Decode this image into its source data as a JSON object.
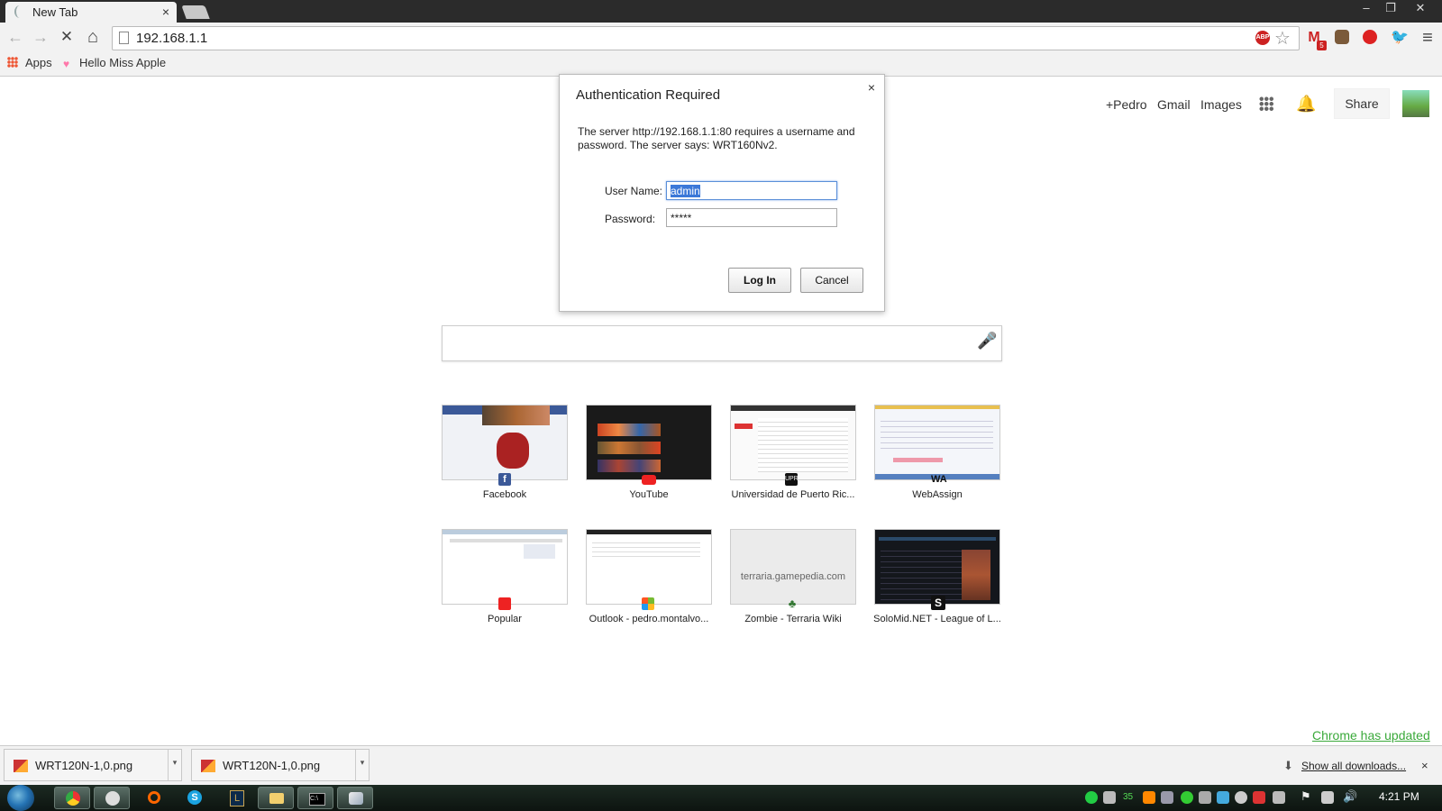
{
  "tab": {
    "title": "New Tab",
    "close": "×"
  },
  "window_controls": {
    "minimize": "–",
    "restore": "❐",
    "close": "✕"
  },
  "toolbar": {
    "back": "←",
    "forward": "→",
    "stop": "✕",
    "home": "⌂",
    "url": "192.168.1.1",
    "abp": "ABP",
    "menu": "≡"
  },
  "extensions": {
    "gmail_badge": "5"
  },
  "bookmarks": [
    {
      "label": "Apps"
    },
    {
      "label": "Hello Miss Apple"
    }
  ],
  "google_header": {
    "plus_name": "+Pedro",
    "gmail": "Gmail",
    "images": "Images",
    "share": "Share"
  },
  "dialog": {
    "title": "Authentication Required",
    "close": "×",
    "message": "The server http://192.168.1.1:80 requires a username and password. The server says: WRT160Nv2.",
    "username_label": "User Name:",
    "username_value": "admin",
    "password_label": "Password:",
    "password_value": "*****",
    "login": "Log In",
    "cancel": "Cancel"
  },
  "tiles": [
    {
      "label": "Facebook"
    },
    {
      "label": "YouTube"
    },
    {
      "label": "Universidad de Puerto Ric..."
    },
    {
      "label": "WebAssign"
    },
    {
      "label": "Popular"
    },
    {
      "label": "Outlook - pedro.montalvo..."
    },
    {
      "label": "Zombie - Terraria Wiki",
      "thumb_text": "terraria.gamepedia.com"
    },
    {
      "label": "SoloMid.NET - League of L..."
    }
  ],
  "downloads": {
    "items": [
      {
        "name": "WRT120N-1,0.png"
      },
      {
        "name": "WRT120N-1,0.png"
      }
    ],
    "show_all": "Show all downloads...",
    "close": "×",
    "chrome_updated": "Chrome has updated"
  },
  "taskbar": {
    "tray_number": "35",
    "clock": "4:21 PM"
  }
}
